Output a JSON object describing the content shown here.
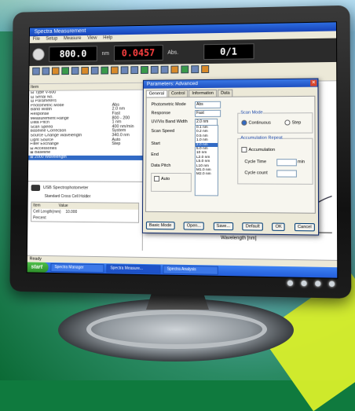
{
  "app": {
    "title": "Spectra Measurement",
    "menu": [
      "File",
      "Setup",
      "Measure",
      "View",
      "Help"
    ],
    "readouts": [
      {
        "value": "800.0",
        "unit": "nm"
      },
      {
        "value": "0.0457",
        "unit": "Abs."
      },
      {
        "value": "0/1",
        "unit": ""
      }
    ]
  },
  "tree": {
    "header": "Item",
    "rows": [
      {
        "label": "⊟ Type V-600",
        "value": ""
      },
      {
        "label": "  ⊟ Serial No.",
        "value": ""
      },
      {
        "label": "  ⊟ Parameters",
        "value": ""
      },
      {
        "label": "      Photometric Mode",
        "value": "Abs"
      },
      {
        "label": "      Band Width",
        "value": "2.0 nm"
      },
      {
        "label": "      Response",
        "value": "Fast"
      },
      {
        "label": "      Measurement Range",
        "value": "800 - 200"
      },
      {
        "label": "      Data Pitch",
        "value": "1 nm"
      },
      {
        "label": "      Scan Speed",
        "value": "400 nm/min"
      },
      {
        "label": "      Baseline Correction",
        "value": "System"
      },
      {
        "label": "      Source Change Wavelength",
        "value": "340.0 nm"
      },
      {
        "label": "      Light Source",
        "value": "Auto"
      },
      {
        "label": "      Filter Exchange",
        "value": "Step"
      },
      {
        "label": "  ⊟ Accessories",
        "value": ""
      },
      {
        "label": "  ⊞ Baseline",
        "value": ""
      },
      {
        "label": "  ⊞ 2000 Wavelength",
        "value": ""
      }
    ],
    "selected_index": 15
  },
  "lower": {
    "instrument": "USB Spectrophotometer",
    "desc": "Standard Cross Cell Holder",
    "table": [
      [
        "Item",
        "Value"
      ],
      [
        "Cell Length(mm)",
        "10.000"
      ],
      [
        "Percent",
        ""
      ]
    ]
  },
  "graph": {
    "xlabel": "Wavelength [nm]"
  },
  "dialog": {
    "title": "Parameters: Advanced",
    "tabs": [
      "General",
      "Control",
      "Information",
      "Data"
    ],
    "fields": [
      {
        "label": "Photometric Mode",
        "value": "Abs"
      },
      {
        "label": "Response",
        "value": "Fast"
      },
      {
        "label": "UV/Vis Band Width",
        "value": "2.0 nm"
      },
      {
        "label": "Scan Speed",
        "value": "400 nm/min"
      },
      {
        "label": "Start",
        "value": "800"
      },
      {
        "label": "End",
        "value": "200"
      },
      {
        "label": "Data Pitch",
        "value": "1"
      }
    ],
    "bandwidth_options": [
      "0.1 nm",
      "0.2 nm",
      "0.5 nm",
      "1.0 nm",
      "2.0 nm",
      "5.0 nm",
      "10 nm",
      "L2.0 nm",
      "L5.0 nm",
      "L10 nm",
      "M1.0 nm",
      "M2.0 nm"
    ],
    "bandwidth_selected": 4,
    "scan_mode_label": "Scan Mode",
    "scan_mode_options": [
      "Continuous",
      "Step"
    ],
    "accumulation_label": "Accumulation Repeat",
    "accumulation_check": "Accumulation",
    "cycle_time_label": "Cycle Time",
    "cycle_time_unit": "min",
    "cycle_count_label": "Cycle count",
    "auto_label": "Auto",
    "buttons": [
      "Basic Mode",
      "Open...",
      "Save...",
      "Default",
      "OK",
      "Cancel"
    ]
  },
  "status": {
    "text": "Ready"
  },
  "taskbar": {
    "start": "start",
    "tasks": [
      "Spectra Manager",
      "Spectra Measure...",
      "Spectra Analysis"
    ]
  },
  "colors": {
    "green": "#0b6a35",
    "accent": "#d9ef2a",
    "winblue": "#245edb"
  }
}
